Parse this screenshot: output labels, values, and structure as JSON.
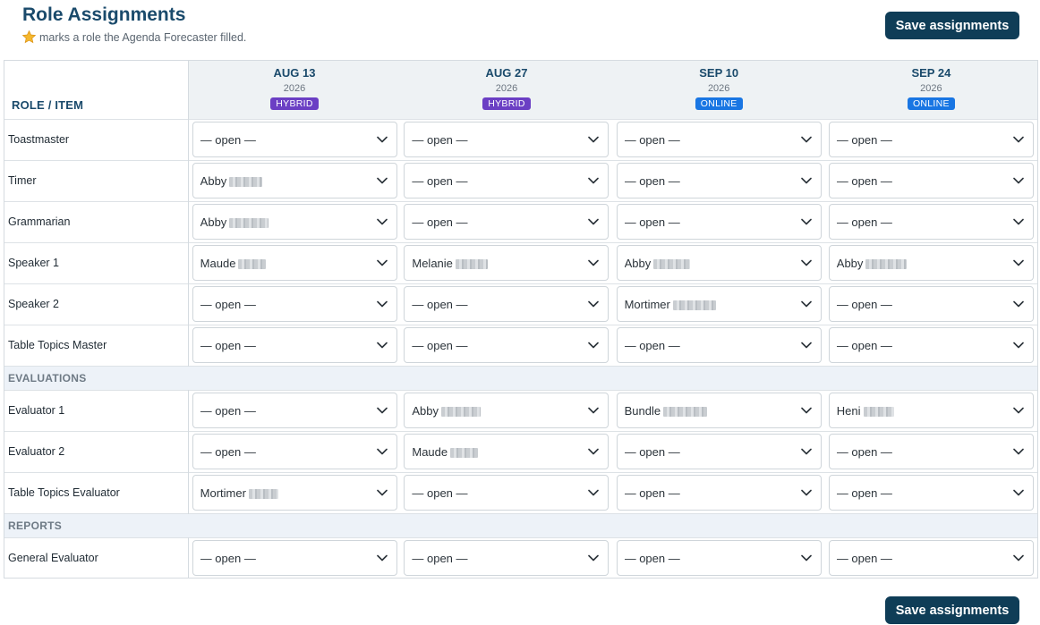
{
  "header": {
    "title": "Role Assignments",
    "subtitle": "marks a role the Agenda Forecaster filled.",
    "star_icon": "star-icon",
    "save_label": "Save assignments"
  },
  "table": {
    "role_header": "ROLE / ITEM",
    "dates": [
      {
        "date": "AUG 13",
        "year": "2026",
        "mode": "HYBRID"
      },
      {
        "date": "AUG 27",
        "year": "2026",
        "mode": "HYBRID"
      },
      {
        "date": "SEP 10",
        "year": "2026",
        "mode": "ONLINE"
      },
      {
        "date": "SEP 24",
        "year": "2026",
        "mode": "ONLINE"
      }
    ],
    "rows": [
      {
        "type": "role",
        "label": "Toastmaster",
        "cells": [
          "— open —",
          "— open —",
          "— open —",
          "— open —"
        ]
      },
      {
        "type": "role",
        "label": "Timer",
        "cells": [
          "Abby",
          "— open —",
          "— open —",
          "— open —"
        ]
      },
      {
        "type": "role",
        "label": "Grammarian",
        "cells": [
          "Abby",
          "— open —",
          "— open —",
          "— open —"
        ]
      },
      {
        "type": "role",
        "label": "Speaker 1",
        "cells": [
          "Maude",
          "Melanie",
          "Abby",
          "Abby"
        ]
      },
      {
        "type": "role",
        "label": "Speaker 2",
        "cells": [
          "— open —",
          "— open —",
          "Mortimer",
          "— open —"
        ]
      },
      {
        "type": "role",
        "label": "Table Topics Master",
        "cells": [
          "— open —",
          "— open —",
          "— open —",
          "— open —"
        ]
      },
      {
        "type": "section",
        "label": "EVALUATIONS"
      },
      {
        "type": "role",
        "label": "Evaluator 1",
        "cells": [
          "— open —",
          "Abby",
          "Bundle",
          "Heni"
        ]
      },
      {
        "type": "role",
        "label": "Evaluator 2",
        "cells": [
          "— open —",
          "Maude",
          "— open —",
          "— open —"
        ]
      },
      {
        "type": "role",
        "label": "Table Topics Evaluator",
        "cells": [
          "Mortimer",
          "— open —",
          "— open —",
          "— open —"
        ]
      },
      {
        "type": "section",
        "label": "REPORTS"
      },
      {
        "type": "role",
        "label": "General Evaluator",
        "cells": [
          "— open —",
          "— open —",
          "— open —",
          "— open —"
        ]
      }
    ]
  },
  "colors": {
    "title": "#1a4a6b",
    "button": "#0f3d57",
    "hybrid": "#6b3fc4",
    "online": "#1976e3",
    "section_bg": "#edf2f8",
    "header_bg": "#eef2f4"
  },
  "icons": {
    "select_arrow": "chevron-down-icon"
  }
}
